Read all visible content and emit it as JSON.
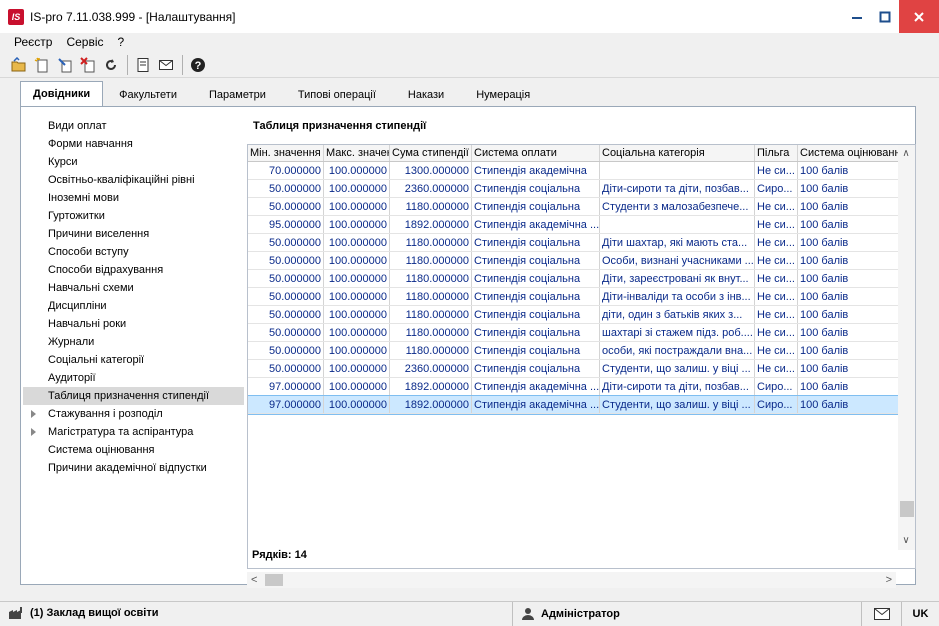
{
  "window": {
    "logo_text": "IS",
    "title": "IS-pro 7.11.038.999 - [Налаштування]"
  },
  "menu": [
    "Реєстр",
    "Сервіс",
    "?"
  ],
  "tabs": [
    "Довідники",
    "Факультети",
    "Параметри",
    "Типові операції",
    "Накази",
    "Нумерація"
  ],
  "tree": [
    {
      "label": "Види оплат",
      "expandable": false
    },
    {
      "label": "Форми навчання",
      "expandable": false
    },
    {
      "label": "Курси",
      "expandable": false
    },
    {
      "label": "Освітньо-кваліфікаційні рівні",
      "expandable": false
    },
    {
      "label": "Іноземні мови",
      "expandable": false
    },
    {
      "label": "Гуртожитки",
      "expandable": false
    },
    {
      "label": "Причини виселення",
      "expandable": false
    },
    {
      "label": "Способи вступу",
      "expandable": false
    },
    {
      "label": "Способи відрахування",
      "expandable": false
    },
    {
      "label": "Навчальні схеми",
      "expandable": false
    },
    {
      "label": "Дисципліни",
      "expandable": false
    },
    {
      "label": "Навчальні роки",
      "expandable": false
    },
    {
      "label": "Журнали",
      "expandable": false
    },
    {
      "label": "Соціальні категорії",
      "expandable": false
    },
    {
      "label": "Аудиторії",
      "expandable": false
    },
    {
      "label": "Таблиця призначення стипендії",
      "expandable": false,
      "selected": true
    },
    {
      "label": "Стажування і розподіл",
      "expandable": true
    },
    {
      "label": "Магістратура та аспірантура",
      "expandable": true
    },
    {
      "label": "Система оцінювання",
      "expandable": false
    },
    {
      "label": "Причини академічної відпустки",
      "expandable": false
    }
  ],
  "panel": {
    "title": "Таблиця призначення стипендії",
    "columns": [
      "Мін. значення",
      "Макс. значення",
      "Сума стипендії",
      "Система оплати",
      "Соціальна категорія",
      "Пільга",
      "Система оцінювання"
    ],
    "rows": [
      [
        "70.000000",
        "100.000000",
        "1300.000000",
        "Стипендія академічна",
        "",
        "Не си...",
        "100 балів"
      ],
      [
        "50.000000",
        "100.000000",
        "2360.000000",
        "Стипендія соціальна",
        "Діти-сироти та діти, позбав...",
        "Сиро...",
        "100 балів"
      ],
      [
        "50.000000",
        "100.000000",
        "1180.000000",
        "Стипендія соціальна",
        "Студенти з малозабезпече...",
        "Не си...",
        "100 балів"
      ],
      [
        "95.000000",
        "100.000000",
        "1892.000000",
        "Стипендія академічна ...",
        "",
        "Не си...",
        "100 балів"
      ],
      [
        "50.000000",
        "100.000000",
        "1180.000000",
        "Стипендія соціальна",
        "Діти шахтар, які мають ста...",
        "Не си...",
        "100 балів"
      ],
      [
        "50.000000",
        "100.000000",
        "1180.000000",
        "Стипендія соціальна",
        "Особи, визнані учасниками ...",
        "Не си...",
        "100 балів"
      ],
      [
        "50.000000",
        "100.000000",
        "1180.000000",
        "Стипендія соціальна",
        "Діти, зареєстровані як внут...",
        "Не си...",
        "100 балів"
      ],
      [
        "50.000000",
        "100.000000",
        "1180.000000",
        "Стипендія соціальна",
        "Діти-інваліди та особи з інв...",
        "Не си...",
        "100 балів"
      ],
      [
        "50.000000",
        "100.000000",
        "1180.000000",
        "Стипендія соціальна",
        "діти, один з батьків яких з...",
        "Не си...",
        "100 балів"
      ],
      [
        "50.000000",
        "100.000000",
        "1180.000000",
        "Стипендія соціальна",
        "шахтарі зі стажем підз. роб....",
        "Не си...",
        "100 балів"
      ],
      [
        "50.000000",
        "100.000000",
        "1180.000000",
        "Стипендія соціальна",
        "особи, які постраждали вна...",
        "Не си...",
        "100 балів"
      ],
      [
        "50.000000",
        "100.000000",
        "2360.000000",
        "Стипендія соціальна",
        "Студенти, що залиш. у віці ...",
        "Не си...",
        "100 балів"
      ],
      [
        "97.000000",
        "100.000000",
        "1892.000000",
        "Стипендія академічна ...",
        "Діти-сироти та діти, позбав...",
        "Сиро...",
        "100 балів"
      ],
      [
        "97.000000",
        "100.000000",
        "1892.000000",
        "Стипендія академічна ...",
        "Студенти, що залиш. у віці ...",
        "Сиро...",
        "100 балів"
      ]
    ],
    "selected_row": 13,
    "row_count_label": "Рядків: 14"
  },
  "status": {
    "organization": "(1) Заклад вищої освіти",
    "user": "Адміністратор",
    "language": "UK"
  }
}
